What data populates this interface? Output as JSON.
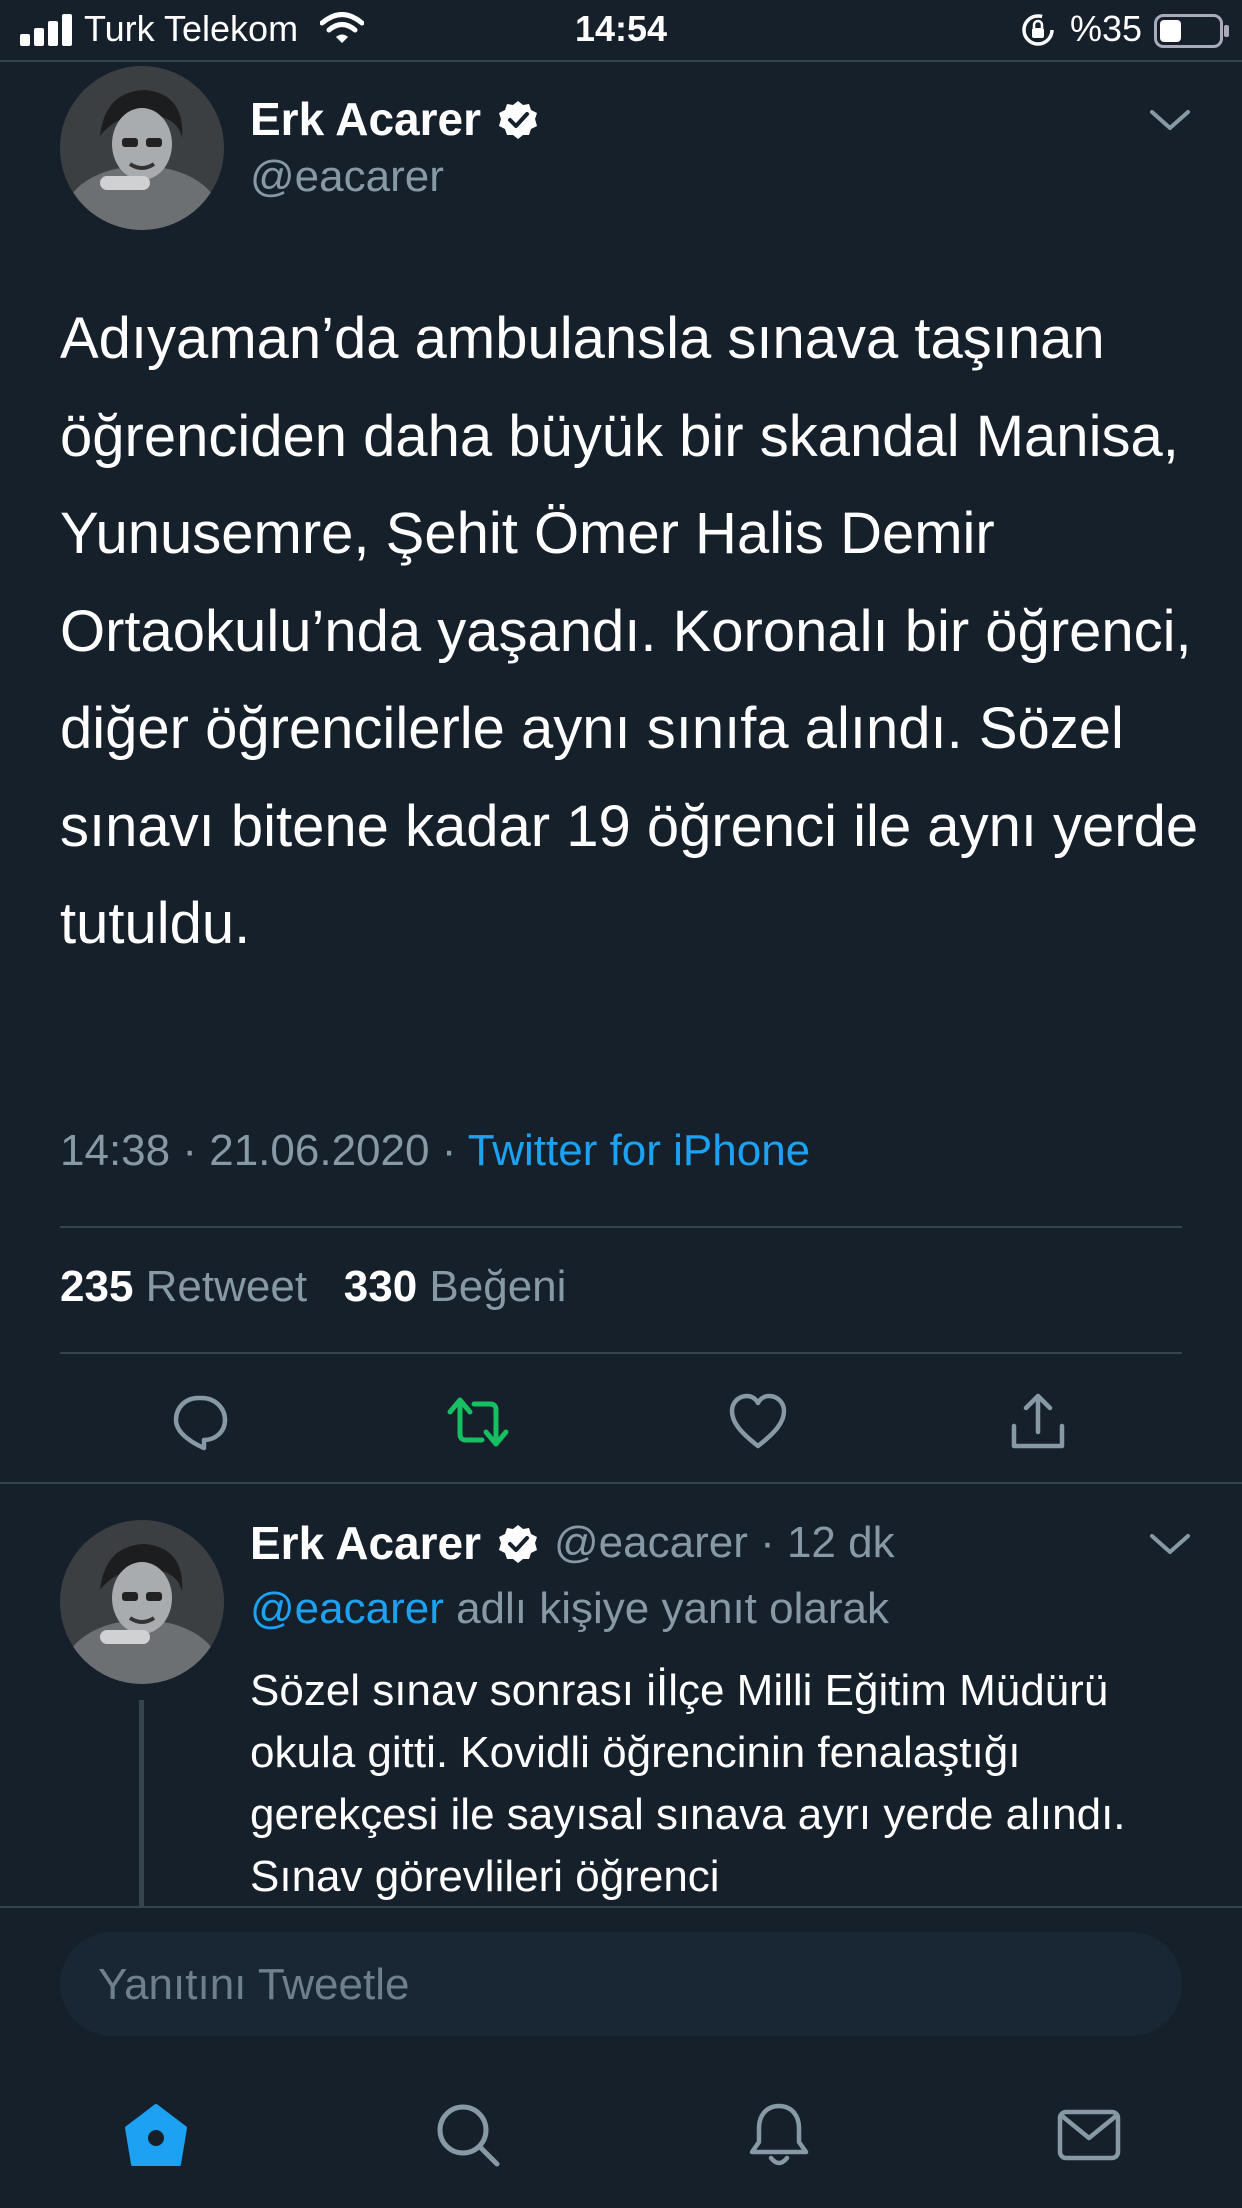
{
  "status_bar": {
    "carrier": "Turk Telekom",
    "time": "14:54",
    "battery": "%35"
  },
  "tweet": {
    "author_name": "Erk Acarer",
    "handle": "@eacarer",
    "text": "Adıyaman’da ambulansla sınava taşınan öğrenciden daha büyük bir skandal Manisa, Yunusemre, Şehit Ömer Halis Demir Ortaokulu’nda yaşandı. Koronalı bir öğrenci, diğer öğrencilerle aynı sınıfa alındı. Sözel sınavı bitene kadar 19 öğrenci ile aynı yerde tutuldu.",
    "time": "14:38",
    "date": "21.06.2020",
    "separator": "·",
    "source": "Twitter for iPhone",
    "retweet_count": "235",
    "retweet_label": "Retweet",
    "like_count": "330",
    "like_label": "Beğeni"
  },
  "reply": {
    "author_name": "Erk Acarer",
    "handle_time": "@eacarer · 12 dk",
    "mention": "@eacarer",
    "reply_suffix": " adlı kişiye yanıt olarak",
    "text": "Sözel sınav sonrası iİlçe Milli Eğitim Müdürü okula gitti. Kovidli öğrencinin fenalaştığı gerekçesi ile sayısal sınava ayrı yerde alındı. Sınav görevlileri öğrenci"
  },
  "compose": {
    "placeholder": "Yanıtını Tweetle"
  },
  "icons": {
    "reply": "comment-icon",
    "retweet": "retweet-icon",
    "like": "heart-icon",
    "share": "share-icon",
    "home": "home-icon",
    "search": "search-icon",
    "notifications": "bell-icon",
    "messages": "mail-icon"
  },
  "colors": {
    "background": "#15202b",
    "accent": "#1da1f2",
    "retweet_active": "#17bf63",
    "secondary_text": "#8899a6",
    "divider": "#38444d"
  }
}
